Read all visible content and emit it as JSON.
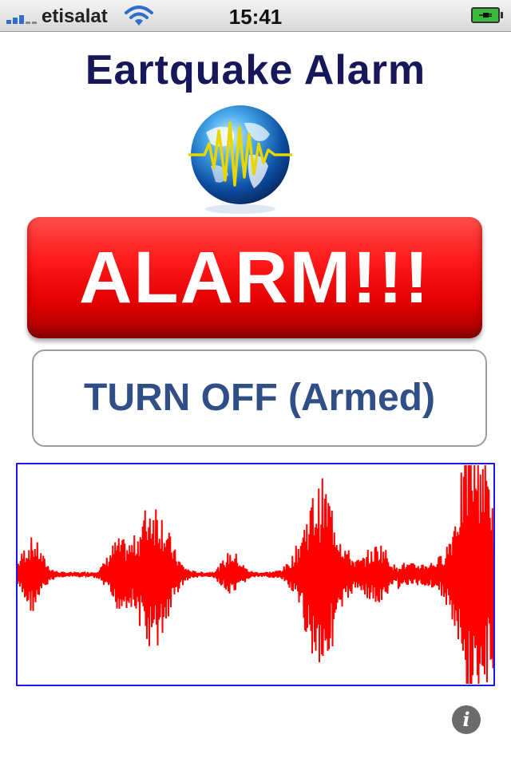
{
  "status_bar": {
    "carrier": "etisalat",
    "time": "15:41",
    "signal_icon": "signal-bars-icon",
    "wifi_icon": "wifi-icon",
    "battery_icon": "battery-charging-icon"
  },
  "app": {
    "title": "Eartquake Alarm",
    "logo_icon": "seismic-globe-icon"
  },
  "alarm_button": {
    "label": "ALARM!!!",
    "color": "#ff1b1b"
  },
  "turn_off_button": {
    "label": "TURN OFF (Armed)",
    "color": "#2f4f86"
  },
  "waveform": {
    "line_color": "#ff0000",
    "border_color": "#1b1be6",
    "events": [
      {
        "position": 0.03,
        "amplitude": 0.16
      },
      {
        "position": 0.21,
        "amplitude": 0.14
      },
      {
        "position": 0.285,
        "amplitude": 0.35
      },
      {
        "position": 0.45,
        "amplitude": 0.1
      },
      {
        "position": 0.635,
        "amplitude": 0.4
      },
      {
        "position": 0.76,
        "amplitude": 0.14
      },
      {
        "position": 0.95,
        "amplitude": 0.22
      },
      {
        "position": 0.975,
        "amplitude": 0.5
      }
    ]
  },
  "info_button": {
    "label": "i",
    "icon": "info-icon"
  }
}
